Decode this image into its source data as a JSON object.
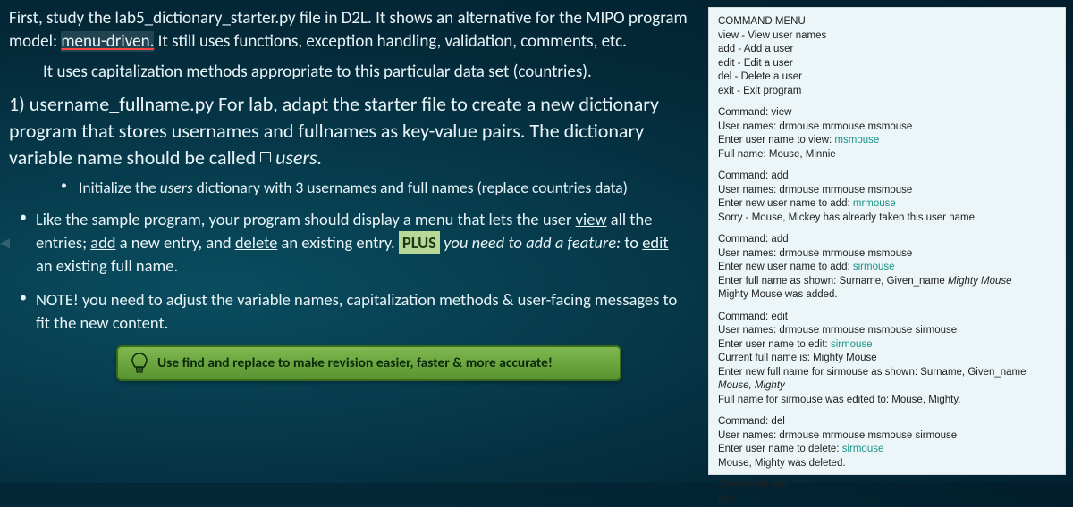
{
  "left": {
    "para1_a": "First, study the lab5_dictionary_starter.py file in D2L. It shows an alternative for the MIPO program model: ",
    "para1_highlight": "menu-driven.",
    "para1_b": " It still uses functions, exception handling, validation, comments, etc.",
    "para2": "It uses capitalization methods  appropriate to this particular data set (countries).",
    "sec1_num": "1) ",
    "sec1_filename": "username_fullname.py",
    "sec1_rest_a": " For lab, adapt the starter file to create a new dictionary program that stores usernames and fullnames as key-value pairs. The dictionary variable name should be called ",
    "sec1_users": " users.",
    "b2_a": "Initialize the ",
    "b2_users": "users",
    "b2_b": " dictionary with 3 usernames and full names (replace countries data)",
    "b3_a": "Like the sample program, your program should display a menu that lets the user ",
    "b3_view": "view",
    "b3_b": " all the entries; ",
    "b3_add": "add",
    "b3_c": " a new entry, and ",
    "b3_delete": "delete",
    "b3_d": " an existing entry. ",
    "b3_plus": "PLUS",
    "b3_e": " you need to add a feature:",
    "b3_f": " to ",
    "b3_edit": "edit",
    "b3_g": " an existing full name.",
    "b4": "NOTE! you need to adjust the variable names, capitalization methods & user-facing messages to fit the new content.",
    "tip": "Use find and replace to make revision easier, faster & more accurate!"
  },
  "console": {
    "menu_title": "COMMAND MENU",
    "menu_items": {
      "view": "view - View user names",
      "add": "add - Add a user",
      "edit": "edit - Edit a user",
      "del": "del - Delete a user",
      "exit": "exit - Exit program"
    },
    "s_view": {
      "l1": "Command: view",
      "l2": "User names: drmouse mrmouse msmouse",
      "l3a": "Enter user name to view: ",
      "l3b": "msmouse",
      "l4": "Full name: Mouse, Minnie"
    },
    "s_add1": {
      "l1": "Command: add",
      "l2": "User names: drmouse mrmouse msmouse",
      "l3a": "Enter new user name to add: ",
      "l3b": "mrmouse",
      "l4": "Sorry - Mouse, Mickey has already taken this user name."
    },
    "s_add2": {
      "l1": "Command: add",
      "l2": "User names: drmouse mrmouse msmouse",
      "l3a": "Enter new user name to add: ",
      "l3b": "sirmouse",
      "l4a": "Enter full name as shown: Surname, Given_name ",
      "l4b": "Mighty Mouse",
      "l5": "Mighty Mouse was added."
    },
    "s_edit": {
      "l1": "Command: edit",
      "l2": "User names: drmouse mrmouse msmouse sirmouse",
      "l3a": "Enter user name to edit: ",
      "l3b": "sirmouse",
      "l4": "Current full name is:  Mighty Mouse",
      "l5a": "Enter new full name for sirmouse as shown: Surname, Given_name ",
      "l5b": "Mouse, Mighty",
      "l6": "Full name for sirmouse was edited to: Mouse, Mighty."
    },
    "s_del": {
      "l1": "Command: del",
      "l2": "User names: drmouse mrmouse msmouse sirmouse",
      "l3a": "Enter user name to delete: ",
      "l3b": "sirmouse",
      "l4": "Mouse, Mighty was deleted."
    },
    "s_exit": {
      "l1": "Command: exit",
      "l2": "Bye!"
    }
  }
}
